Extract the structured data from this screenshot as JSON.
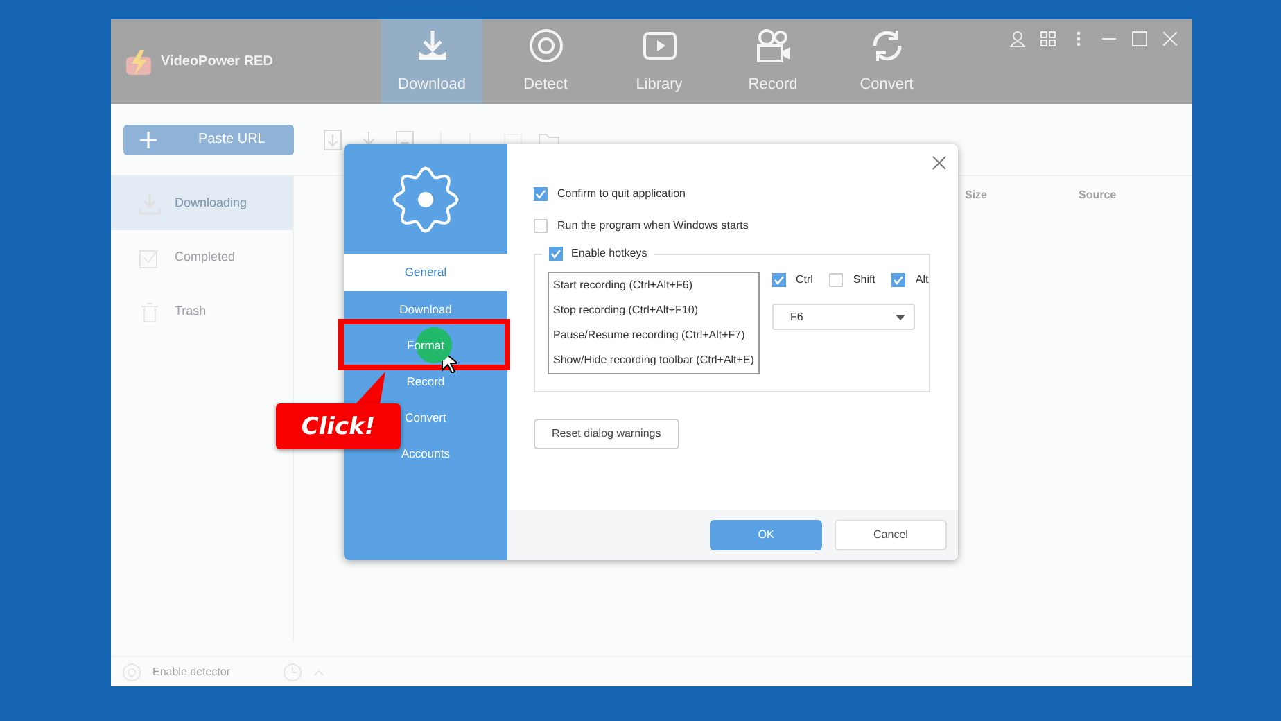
{
  "app": {
    "title": "VideoPower RED",
    "nav_tabs": [
      {
        "label": "Download",
        "selected": true
      },
      {
        "label": "Detect",
        "selected": false
      },
      {
        "label": "Library",
        "selected": false
      },
      {
        "label": "Record",
        "selected": false
      },
      {
        "label": "Convert",
        "selected": false
      }
    ],
    "paste_url_button": "Paste URL",
    "sidebar_items": [
      {
        "label": "Downloading",
        "selected": true
      },
      {
        "label": "Completed",
        "selected": false
      },
      {
        "label": "Trash",
        "selected": false
      }
    ],
    "columns": [
      "Size",
      "Source"
    ],
    "status_bar": {
      "detector_label": "Enable detector"
    }
  },
  "dialog": {
    "nav": [
      {
        "label": "General",
        "selected": true
      },
      {
        "label": "Download",
        "selected": false
      },
      {
        "label": "Format",
        "selected": false
      },
      {
        "label": "Record",
        "selected": false
      },
      {
        "label": "Convert",
        "selected": false
      },
      {
        "label": "Accounts",
        "selected": false
      }
    ],
    "options": [
      {
        "label": "Confirm to quit application",
        "checked": true
      },
      {
        "label": "Run the program when Windows starts",
        "checked": false
      }
    ],
    "hotkeys": {
      "label": "Enable hotkeys",
      "checked": true,
      "actions": [
        "Start recording (Ctrl+Alt+F6)",
        "Stop recording (Ctrl+Alt+F10)",
        "Pause/Resume recording (Ctrl+Alt+F7)",
        "Show/Hide recording toolbar (Ctrl+Alt+E)"
      ],
      "modifiers": [
        {
          "label": "Ctrl",
          "checked": true
        },
        {
          "label": "Shift",
          "checked": false
        },
        {
          "label": "Alt",
          "checked": true
        }
      ],
      "key": "F6"
    },
    "reset_button": "Reset dialog warnings",
    "ok_button": "OK",
    "cancel_button": "Cancel"
  },
  "callout": {
    "text": "Click!"
  }
}
